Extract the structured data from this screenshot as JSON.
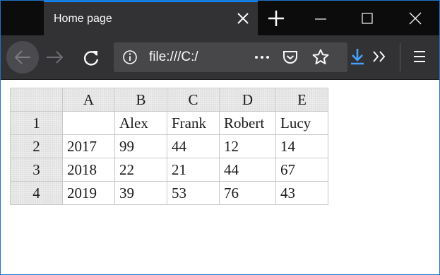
{
  "browser": {
    "tab_title": "Home page",
    "url": "file:///C:/",
    "colors": {
      "tabstrip": "#0c0c0d",
      "toolbar": "#323234",
      "accent": "#0a84ff",
      "download": "#45a1ff"
    }
  },
  "icons": [
    "close-icon",
    "plus-icon",
    "minimize-icon",
    "maximize-icon",
    "window-close-icon",
    "back-arrow-icon",
    "forward-arrow-icon",
    "reload-icon",
    "info-icon",
    "more-icon",
    "pocket-icon",
    "star-icon",
    "download-icon",
    "overflow-icon",
    "hamburger-menu-icon"
  ],
  "sheet": {
    "columns": [
      "A",
      "B",
      "C",
      "D",
      "E"
    ],
    "rows": [
      {
        "num": "1",
        "cells": [
          "",
          "Alex",
          "Frank",
          "Robert",
          "Lucy"
        ]
      },
      {
        "num": "2",
        "cells": [
          "2017",
          "99",
          "44",
          "12",
          "14"
        ]
      },
      {
        "num": "3",
        "cells": [
          "2018",
          "22",
          "21",
          "44",
          "67"
        ]
      },
      {
        "num": "4",
        "cells": [
          "2019",
          "39",
          "53",
          "76",
          "43"
        ]
      }
    ]
  }
}
